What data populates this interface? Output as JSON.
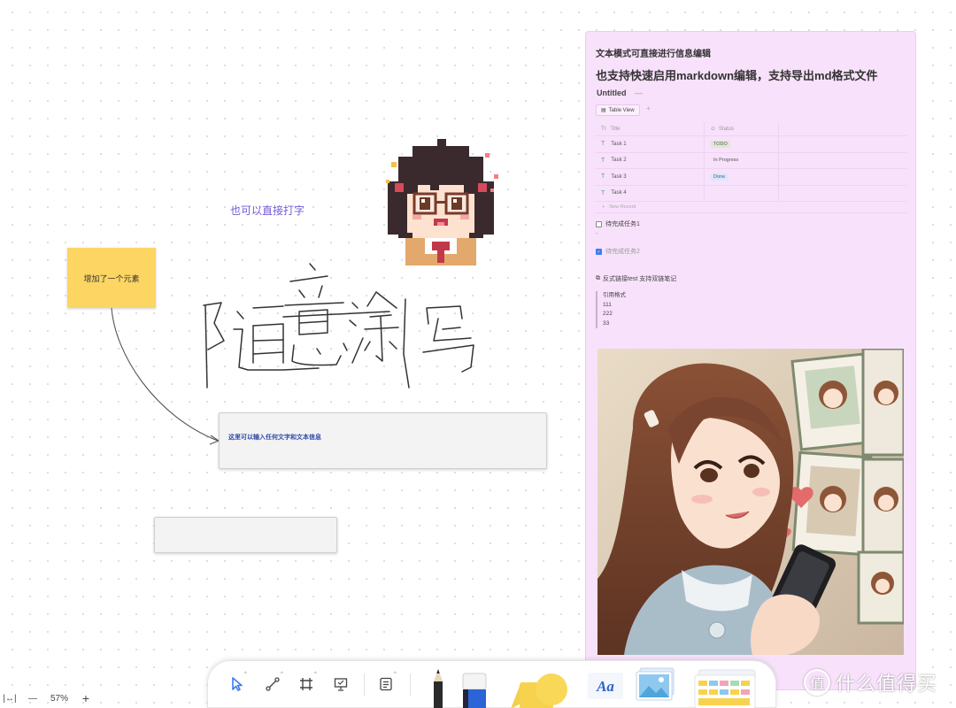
{
  "canvas": {
    "floating_text": "也可以直接打字",
    "sticky_note": "增加了一个元素",
    "text_box": "这里可以输入任何文字和文本信息",
    "handwriting_strokes": "随意涂写"
  },
  "doc_panel": {
    "heading_small": "文本模式可直接进行信息编辑",
    "heading_large": "也支持快速启用markdown编辑，支持导出md格式文件",
    "database": {
      "title": "Untitled",
      "title_separator": "—",
      "view_tab": "Table View",
      "view_add": "+",
      "columns": [
        "Title",
        "Status"
      ],
      "rows": [
        {
          "title": "Task 1",
          "status": "TODO",
          "status_bg": "#dfe6d9",
          "status_color": "#4a6a3e"
        },
        {
          "title": "Task 2",
          "status": "In Progress",
          "status_bg": "transparent",
          "status_color": "#555555"
        },
        {
          "title": "Task 3",
          "status": "Done",
          "status_bg": "#dbe7f7",
          "status_color": "#3b5f9a"
        },
        {
          "title": "Task 4",
          "status": "",
          "status_bg": "transparent",
          "status_color": "#555555"
        }
      ],
      "new_record": "New Record"
    },
    "todos": [
      {
        "label": "待完成任务1",
        "checked": false
      },
      {
        "label": "待完成任务2",
        "checked": true
      }
    ],
    "stray_char": "`",
    "backlink": "反式链接test 支持双链笔记",
    "quote_lines": [
      "引用格式",
      "111",
      "222",
      "33"
    ]
  },
  "toolbar": {
    "tools": [
      "select-tool",
      "connector-tool",
      "frame-tool",
      "presentation-tool",
      "note-tool",
      "pen-tool",
      "eraser-tool",
      "shape-tool",
      "text-tool",
      "image-tool",
      "template-tool"
    ]
  },
  "zoom": {
    "fit_icon": "|↔|",
    "minus": "—",
    "level": "57%",
    "plus": "+"
  },
  "watermark": {
    "logo_char": "值",
    "text": "什么值得买"
  },
  "colors": {
    "accent": "#7459d6",
    "sticky": "#fcd562",
    "panel": "#f8e1fb",
    "checkbox": "#3d7cf2"
  }
}
